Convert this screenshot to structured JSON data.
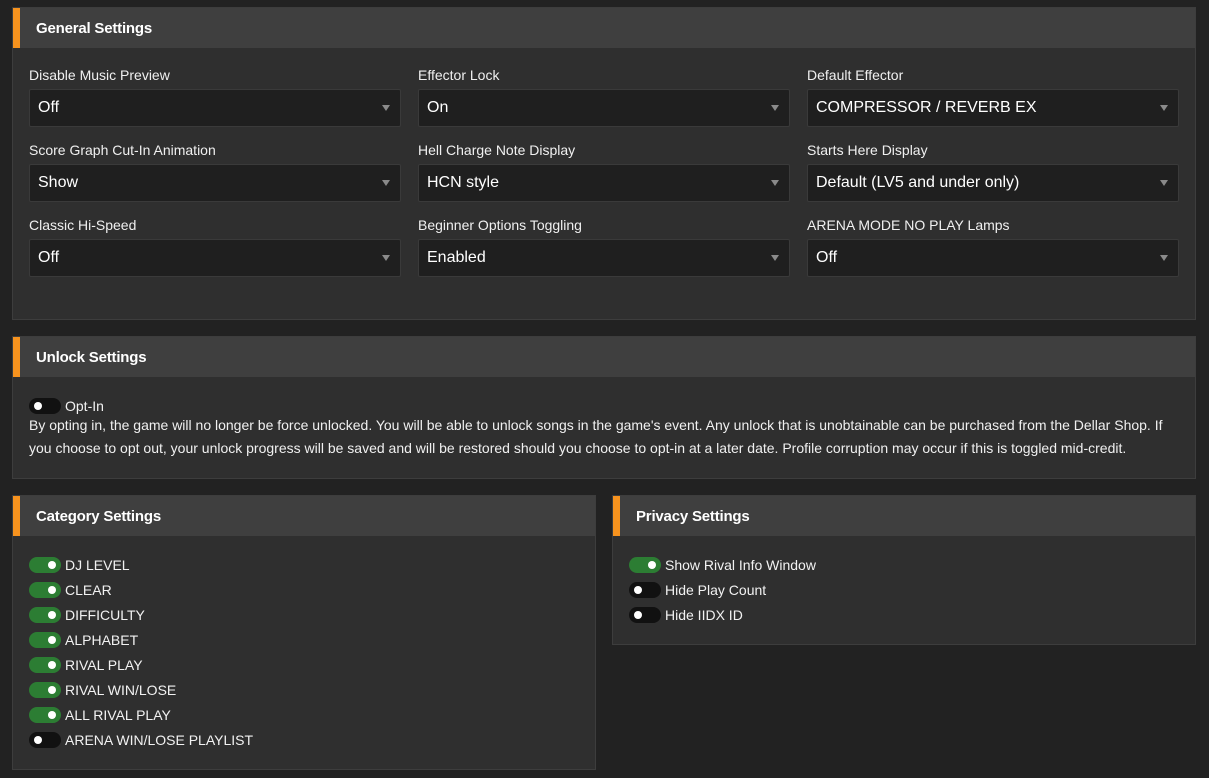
{
  "general": {
    "title": "General Settings",
    "fields": [
      {
        "label": "Disable Music Preview",
        "value": "Off"
      },
      {
        "label": "Effector Lock",
        "value": "On"
      },
      {
        "label": "Default Effector",
        "value": "COMPRESSOR / REVERB EX"
      },
      {
        "label": "Score Graph Cut-In Animation",
        "value": "Show"
      },
      {
        "label": "Hell Charge Note Display",
        "value": "HCN style"
      },
      {
        "label": "Starts Here Display",
        "value": "Default (LV5 and under only)"
      },
      {
        "label": "Classic Hi-Speed",
        "value": "Off"
      },
      {
        "label": "Beginner Options Toggling",
        "value": "Enabled"
      },
      {
        "label": "ARENA MODE NO PLAY Lamps",
        "value": "Off"
      }
    ]
  },
  "unlock": {
    "title": "Unlock Settings",
    "toggle": {
      "label": "Opt-In",
      "on": false
    },
    "description": "By opting in, the game will no longer be force unlocked. You will be able to unlock songs in the game's event. Any unlock that is unobtainable can be purchased from the Dellar Shop. If you choose to opt out, your unlock progress will be saved and will be restored should you choose to opt-in at a later date. Profile corruption may occur if this is toggled mid-credit."
  },
  "category": {
    "title": "Category Settings",
    "toggles": [
      {
        "label": "DJ LEVEL",
        "on": true
      },
      {
        "label": "CLEAR",
        "on": true
      },
      {
        "label": "DIFFICULTY",
        "on": true
      },
      {
        "label": "ALPHABET",
        "on": true
      },
      {
        "label": "RIVAL PLAY",
        "on": true
      },
      {
        "label": "RIVAL WIN/LOSE",
        "on": true
      },
      {
        "label": "ALL RIVAL PLAY",
        "on": true
      },
      {
        "label": "ARENA WIN/LOSE PLAYLIST",
        "on": false
      }
    ]
  },
  "privacy": {
    "title": "Privacy Settings",
    "toggles": [
      {
        "label": "Show Rival Info Window",
        "on": true
      },
      {
        "label": "Hide Play Count",
        "on": false
      },
      {
        "label": "Hide IIDX ID",
        "on": false
      }
    ]
  },
  "colors": {
    "accent": "#f7931e",
    "toggle_on": "#2c7d33",
    "toggle_off": "#111111",
    "panel": "#2f2f2f",
    "header": "#3f3f3f",
    "background": "#222222"
  }
}
